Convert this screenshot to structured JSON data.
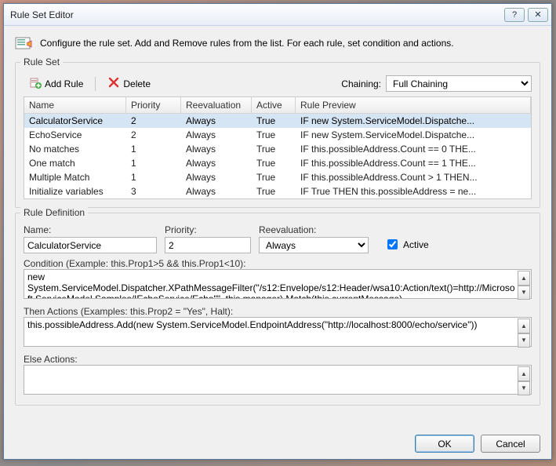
{
  "window": {
    "title": "Rule Set Editor"
  },
  "intro": {
    "text": "Configure the rule set. Add and Remove rules from the list. For each rule, set condition and actions."
  },
  "ruleset_group": {
    "title": "Rule Set"
  },
  "toolbar": {
    "add": "Add Rule",
    "delete": "Delete",
    "chaining_label": "Chaining:",
    "chaining_value": "Full Chaining"
  },
  "columns": {
    "name": "Name",
    "priority": "Priority",
    "reeval": "Reevaluation",
    "active": "Active",
    "preview": "Rule Preview"
  },
  "rules": [
    {
      "name": "CalculatorService",
      "priority": "2",
      "reeval": "Always",
      "active": "True",
      "preview": "IF new System.ServiceModel.Dispatche..."
    },
    {
      "name": "EchoService",
      "priority": "2",
      "reeval": "Always",
      "active": "True",
      "preview": "IF new System.ServiceModel.Dispatche..."
    },
    {
      "name": "No matches",
      "priority": "1",
      "reeval": "Always",
      "active": "True",
      "preview": "IF this.possibleAddress.Count == 0 THE..."
    },
    {
      "name": "One match",
      "priority": "1",
      "reeval": "Always",
      "active": "True",
      "preview": "IF this.possibleAddress.Count == 1 THE..."
    },
    {
      "name": "Multiple Match",
      "priority": "1",
      "reeval": "Always",
      "active": "True",
      "preview": "IF this.possibleAddress.Count > 1 THEN..."
    },
    {
      "name": "Initialize variables",
      "priority": "3",
      "reeval": "Always",
      "active": "True",
      "preview": "IF True THEN this.possibleAddress = ne..."
    }
  ],
  "def_group": {
    "title": "Rule Definition"
  },
  "def": {
    "name_label": "Name:",
    "name_value": "CalculatorService",
    "priority_label": "Priority:",
    "priority_value": "2",
    "reeval_label": "Reevaluation:",
    "reeval_value": "Always",
    "active_label": "Active"
  },
  "condition": {
    "label": "Condition (Example: this.Prop1>5 && this.Prop1<10):",
    "value": "new System.ServiceModel.Dispatcher.XPathMessageFilter(\"/s12:Envelope/s12:Header/wsa10:Action/text()=http://Microsoft.ServiceModel.Samples/IEchoService/Echo\"\", this.manager).Match(this.currentMessage)"
  },
  "then": {
    "label": "Then Actions (Examples: this.Prop2 = \"Yes\", Halt):",
    "value": "this.possibleAddress.Add(new System.ServiceModel.EndpointAddress(\"http://localhost:8000/echo/service\"))"
  },
  "elseblk": {
    "label": "Else Actions:",
    "value": ""
  },
  "footer": {
    "ok": "OK",
    "cancel": "Cancel"
  }
}
